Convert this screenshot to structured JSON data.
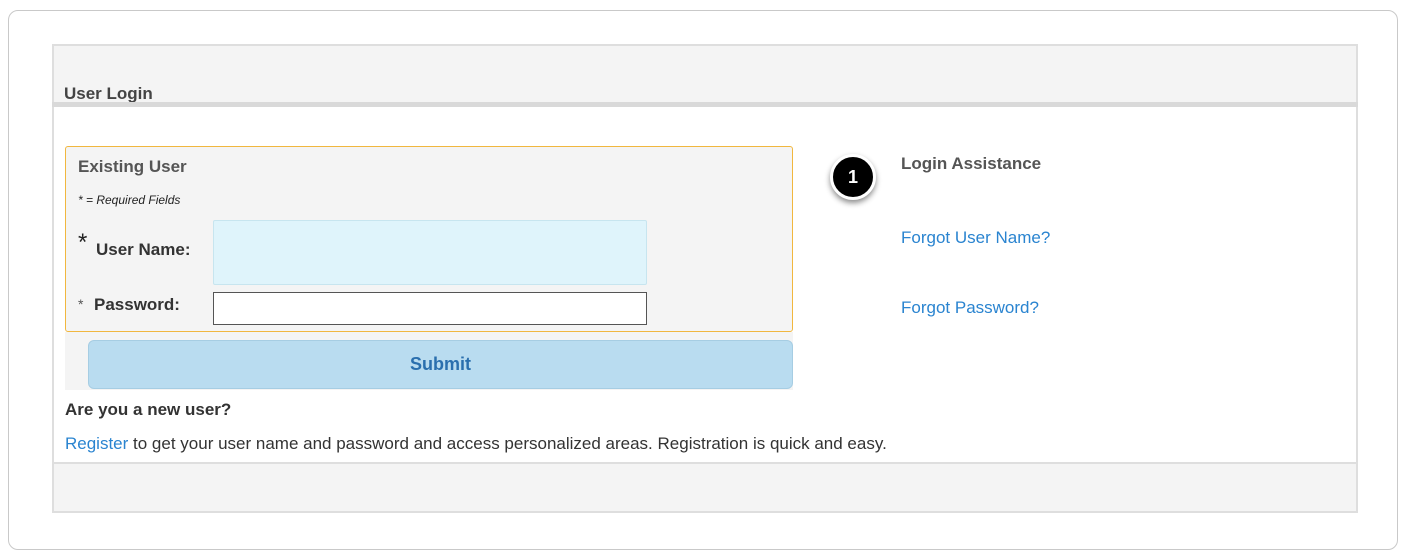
{
  "header": {
    "title": "User Login"
  },
  "existing_user": {
    "title": "Existing User",
    "required_note": "* = Required Fields",
    "username_star": "*",
    "username_label": "User Name:",
    "username_value": "",
    "password_star": "*",
    "password_label": "Password:",
    "password_value": "",
    "submit_label": "Submit"
  },
  "new_user": {
    "question": "Are you a new user?",
    "register_link": "Register",
    "register_text": " to get your user name and password and access personalized areas. Registration is quick and easy."
  },
  "assistance": {
    "callout_number": "1",
    "title": "Login Assistance",
    "forgot_username": "Forgot User Name?",
    "forgot_password": "Forgot Password?"
  },
  "colors": {
    "link": "#2a84d0",
    "accent_border": "#f1b73f",
    "submit_bg": "#b9dcf0",
    "username_bg": "#dff4fb"
  }
}
